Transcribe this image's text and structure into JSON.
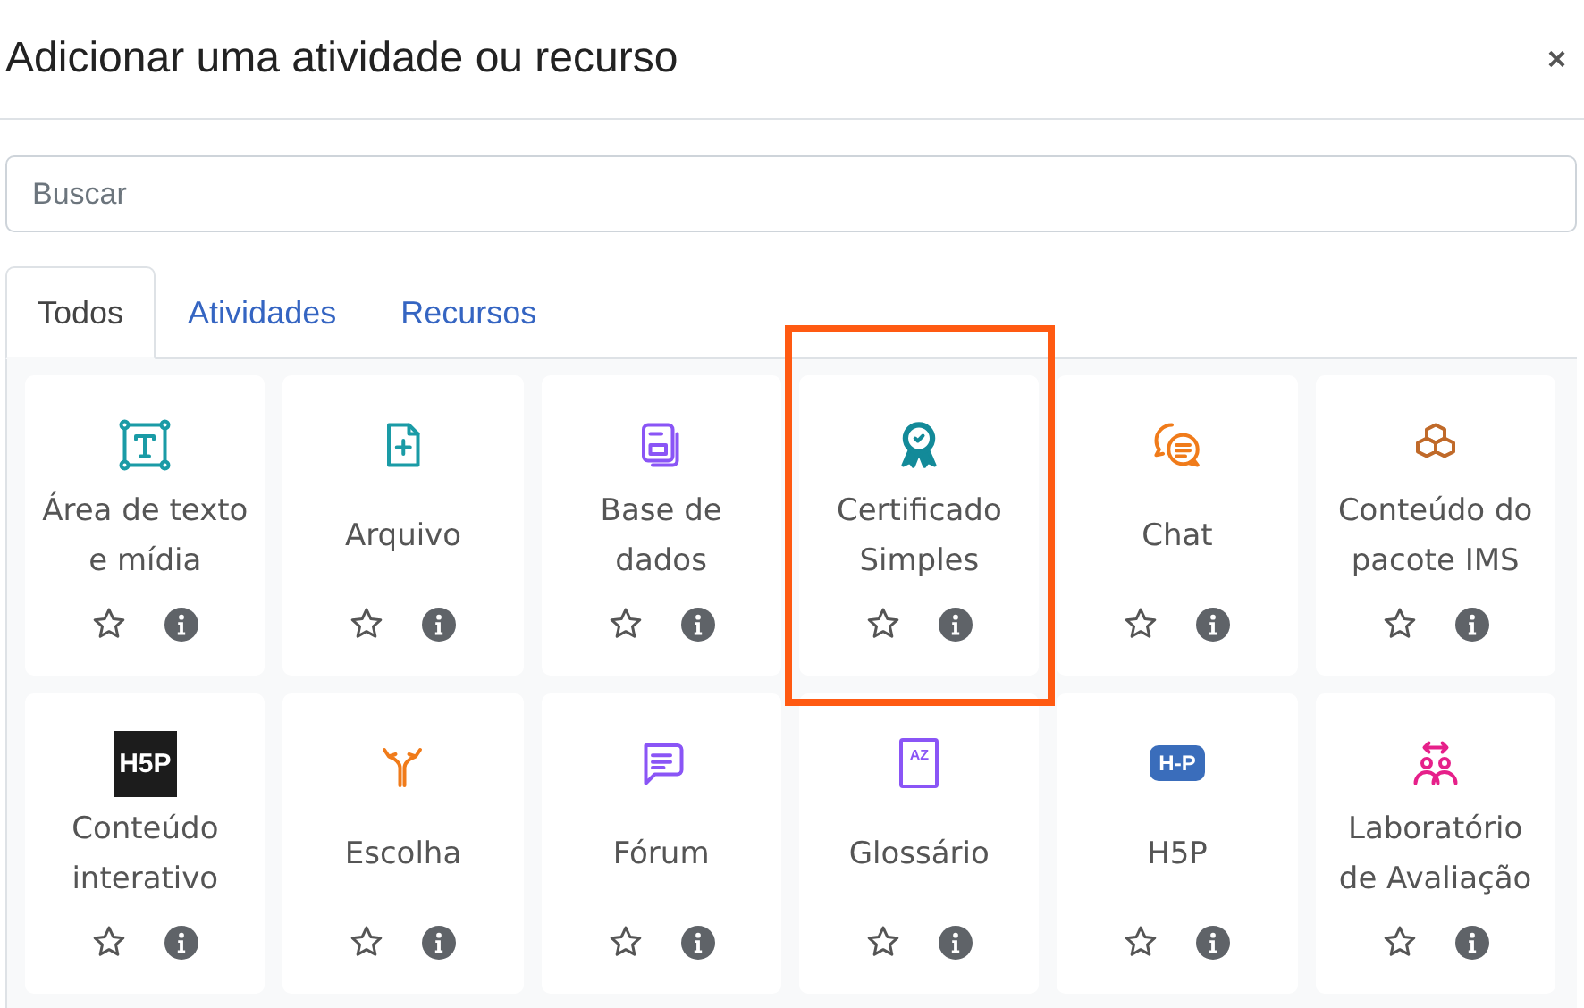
{
  "dialog": {
    "title": "Adicionar uma atividade ou recurso",
    "close": "×"
  },
  "search": {
    "placeholder": "Buscar"
  },
  "tabs": [
    {
      "label": "Todos",
      "selected": true
    },
    {
      "label": "Atividades",
      "selected": false
    },
    {
      "label": "Recursos",
      "selected": false
    }
  ],
  "items": [
    {
      "name": "Área de texto e mídia",
      "highlighted": false
    },
    {
      "name": "Arquivo",
      "highlighted": false
    },
    {
      "name": "Base de dados",
      "highlighted": false
    },
    {
      "name": "Certificado Simples",
      "highlighted": true
    },
    {
      "name": "Chat",
      "highlighted": false
    },
    {
      "name": "Conteúdo do pacote IMS",
      "highlighted": false
    },
    {
      "name": "Conteúdo interativo",
      "highlighted": false,
      "icon_text": "H5P"
    },
    {
      "name": "Escolha",
      "highlighted": false
    },
    {
      "name": "Fórum",
      "highlighted": false
    },
    {
      "name": "Glossário",
      "highlighted": false,
      "icon_text": "AZ"
    },
    {
      "name": "H5P",
      "highlighted": false,
      "icon_text": "H-P"
    },
    {
      "name": "Laboratório de Avaliação",
      "highlighted": false
    }
  ]
}
